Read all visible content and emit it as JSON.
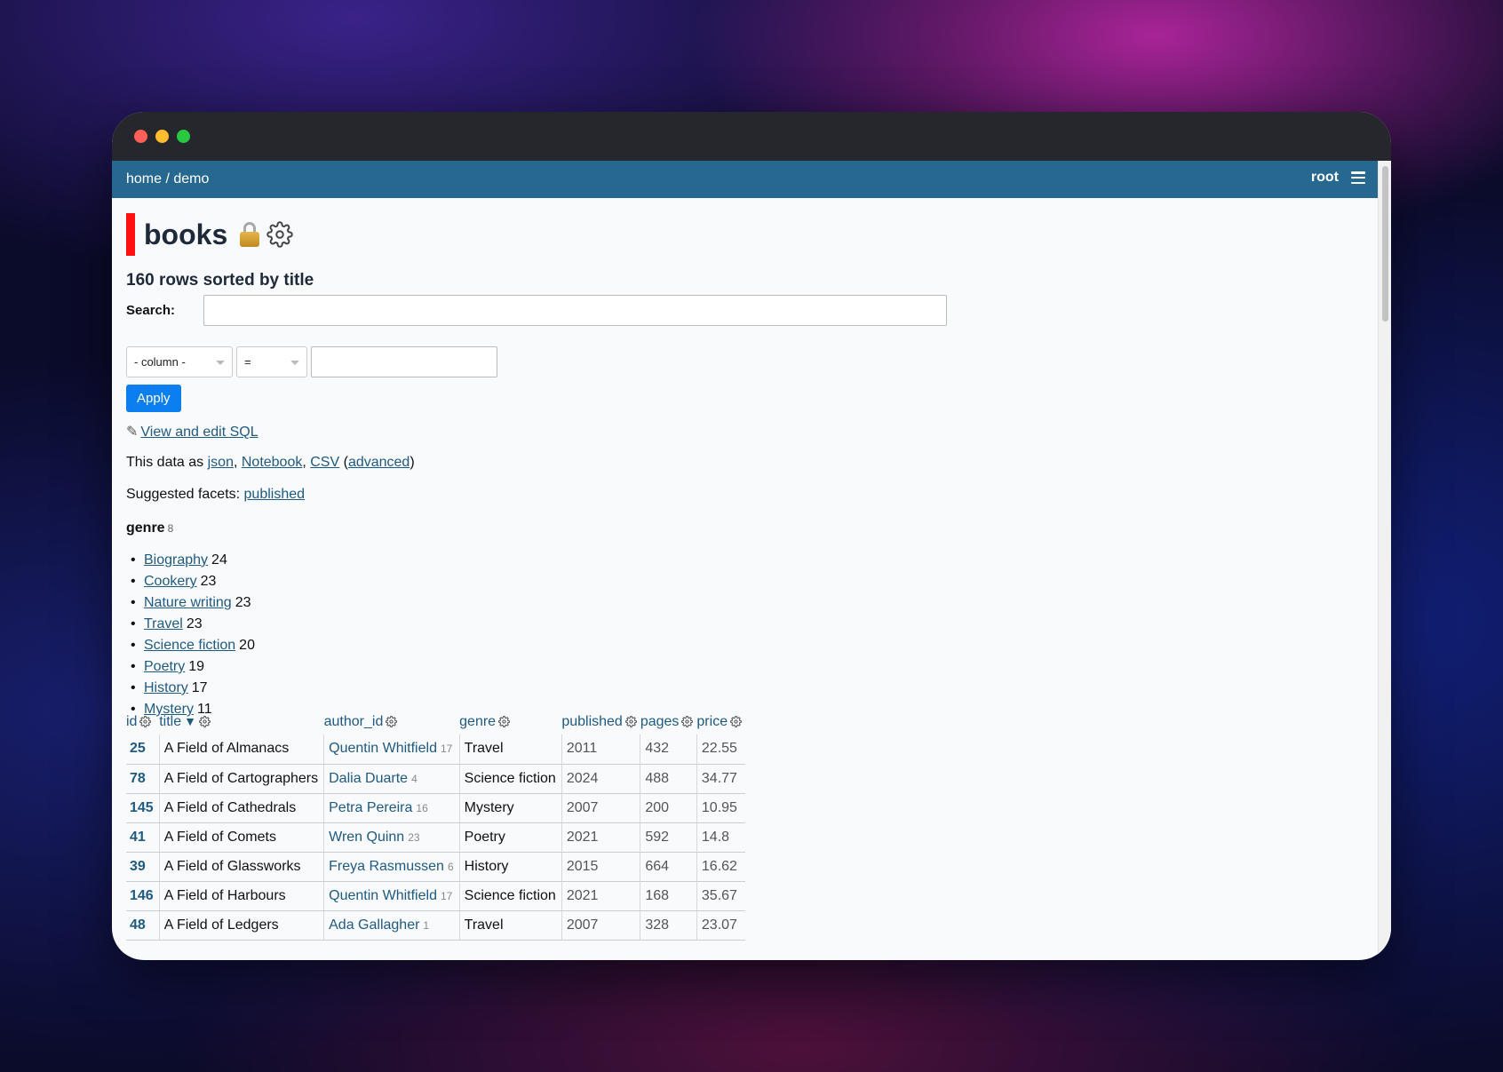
{
  "nav": {
    "home": "home",
    "sep": " / ",
    "db": "demo",
    "user": "root"
  },
  "page": {
    "title": "books",
    "rowcount": "160 rows sorted by title"
  },
  "search": {
    "label": "Search:",
    "value": ""
  },
  "filter": {
    "column": "- column -",
    "operator": "=",
    "value": "",
    "apply": "Apply"
  },
  "sql": {
    "pencil": "✎",
    "link": "View and edit SQL"
  },
  "export": {
    "prefix": "This data as ",
    "json": "json",
    "notebook": "Notebook",
    "csv": "CSV",
    "advanced": "advanced"
  },
  "suggested": {
    "prefix": "Suggested facets: ",
    "link": "published"
  },
  "facet": {
    "name": "genre",
    "count": "8",
    "items": [
      {
        "label": "Biography",
        "count": "24"
      },
      {
        "label": "Cookery",
        "count": "23"
      },
      {
        "label": "Nature writing",
        "count": "23"
      },
      {
        "label": "Travel",
        "count": "23"
      },
      {
        "label": "Science fiction",
        "count": "20"
      },
      {
        "label": "Poetry",
        "count": "19"
      },
      {
        "label": "History",
        "count": "17"
      },
      {
        "label": "Mystery",
        "count": "11"
      }
    ]
  },
  "table": {
    "columns": [
      "id",
      "title",
      "author_id",
      "genre",
      "published",
      "pages",
      "price"
    ],
    "rows": [
      {
        "id": "25",
        "title": "A Field of Almanacs",
        "author": "Quentin Whitfield",
        "author_id": "17",
        "genre": "Travel",
        "published": "2011",
        "pages": "432",
        "price": "22.55"
      },
      {
        "id": "78",
        "title": "A Field of Cartographers",
        "author": "Dalia Duarte",
        "author_id": "4",
        "genre": "Science fiction",
        "published": "2024",
        "pages": "488",
        "price": "34.77"
      },
      {
        "id": "145",
        "title": "A Field of Cathedrals",
        "author": "Petra Pereira",
        "author_id": "16",
        "genre": "Mystery",
        "published": "2007",
        "pages": "200",
        "price": "10.95"
      },
      {
        "id": "41",
        "title": "A Field of Comets",
        "author": "Wren Quinn",
        "author_id": "23",
        "genre": "Poetry",
        "published": "2021",
        "pages": "592",
        "price": "14.8"
      },
      {
        "id": "39",
        "title": "A Field of Glassworks",
        "author": "Freya Rasmussen",
        "author_id": "6",
        "genre": "History",
        "published": "2015",
        "pages": "664",
        "price": "16.62"
      },
      {
        "id": "146",
        "title": "A Field of Harbours",
        "author": "Quentin Whitfield",
        "author_id": "17",
        "genre": "Science fiction",
        "published": "2021",
        "pages": "168",
        "price": "35.67"
      },
      {
        "id": "48",
        "title": "A Field of Ledgers",
        "author": "Ada Gallagher",
        "author_id": "1",
        "genre": "Travel",
        "published": "2007",
        "pages": "328",
        "price": "23.07"
      }
    ]
  },
  "icons": {
    "lock": "lock-icon",
    "gear": "gear-icon",
    "menu": "hamburger-icon",
    "sort": "sort-desc-icon"
  },
  "colors": {
    "navbar": "#276890",
    "accent": "#ff1111",
    "link": "#1f5a80",
    "apply": "#0b7ef0"
  }
}
